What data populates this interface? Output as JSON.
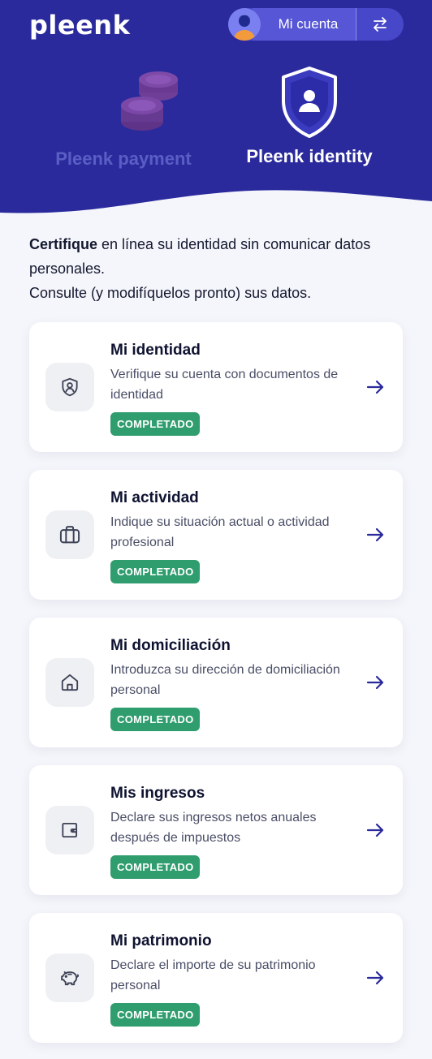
{
  "header": {
    "logo": "pleenk",
    "account_label": "Mi cuenta",
    "switch_icon": "swap-arrows-icon",
    "products": [
      {
        "name": "Pleenk payment",
        "icon": "coins-icon",
        "active": false
      },
      {
        "name": "Pleenk identity",
        "icon": "shield-user-icon",
        "active": true
      }
    ]
  },
  "intro": {
    "bold": "Certifique",
    "line1_rest": " en línea su identidad sin comunicar datos personales.",
    "line2": "Consulte (y modifíquelos pronto) sus datos."
  },
  "cards": [
    {
      "title": "Mi identidad",
      "description": "Verifique su cuenta con documentos de identidad",
      "status": "COMPLETADO",
      "icon": "shield-user-icon"
    },
    {
      "title": "Mi actividad",
      "description": "Indique su situación actual o actividad profesional",
      "status": "COMPLETADO",
      "icon": "briefcase-icon"
    },
    {
      "title": "Mi domiciliación",
      "description": "Introduzca su dirección de domiciliación personal",
      "status": "COMPLETADO",
      "icon": "home-icon"
    },
    {
      "title": "Mis ingresos",
      "description": "Declare sus ingresos netos anuales después de impuestos",
      "status": "COMPLETADO",
      "icon": "wallet-icon"
    },
    {
      "title": "Mi patrimonio",
      "description": "Declare el importe de su patrimonio personal",
      "status": "COMPLETADO",
      "icon": "piggy-bank-icon"
    }
  ],
  "colors": {
    "brand": "#2a2a9d",
    "status_completed": "#2f9d6e",
    "arrow": "#2a2a9d"
  }
}
